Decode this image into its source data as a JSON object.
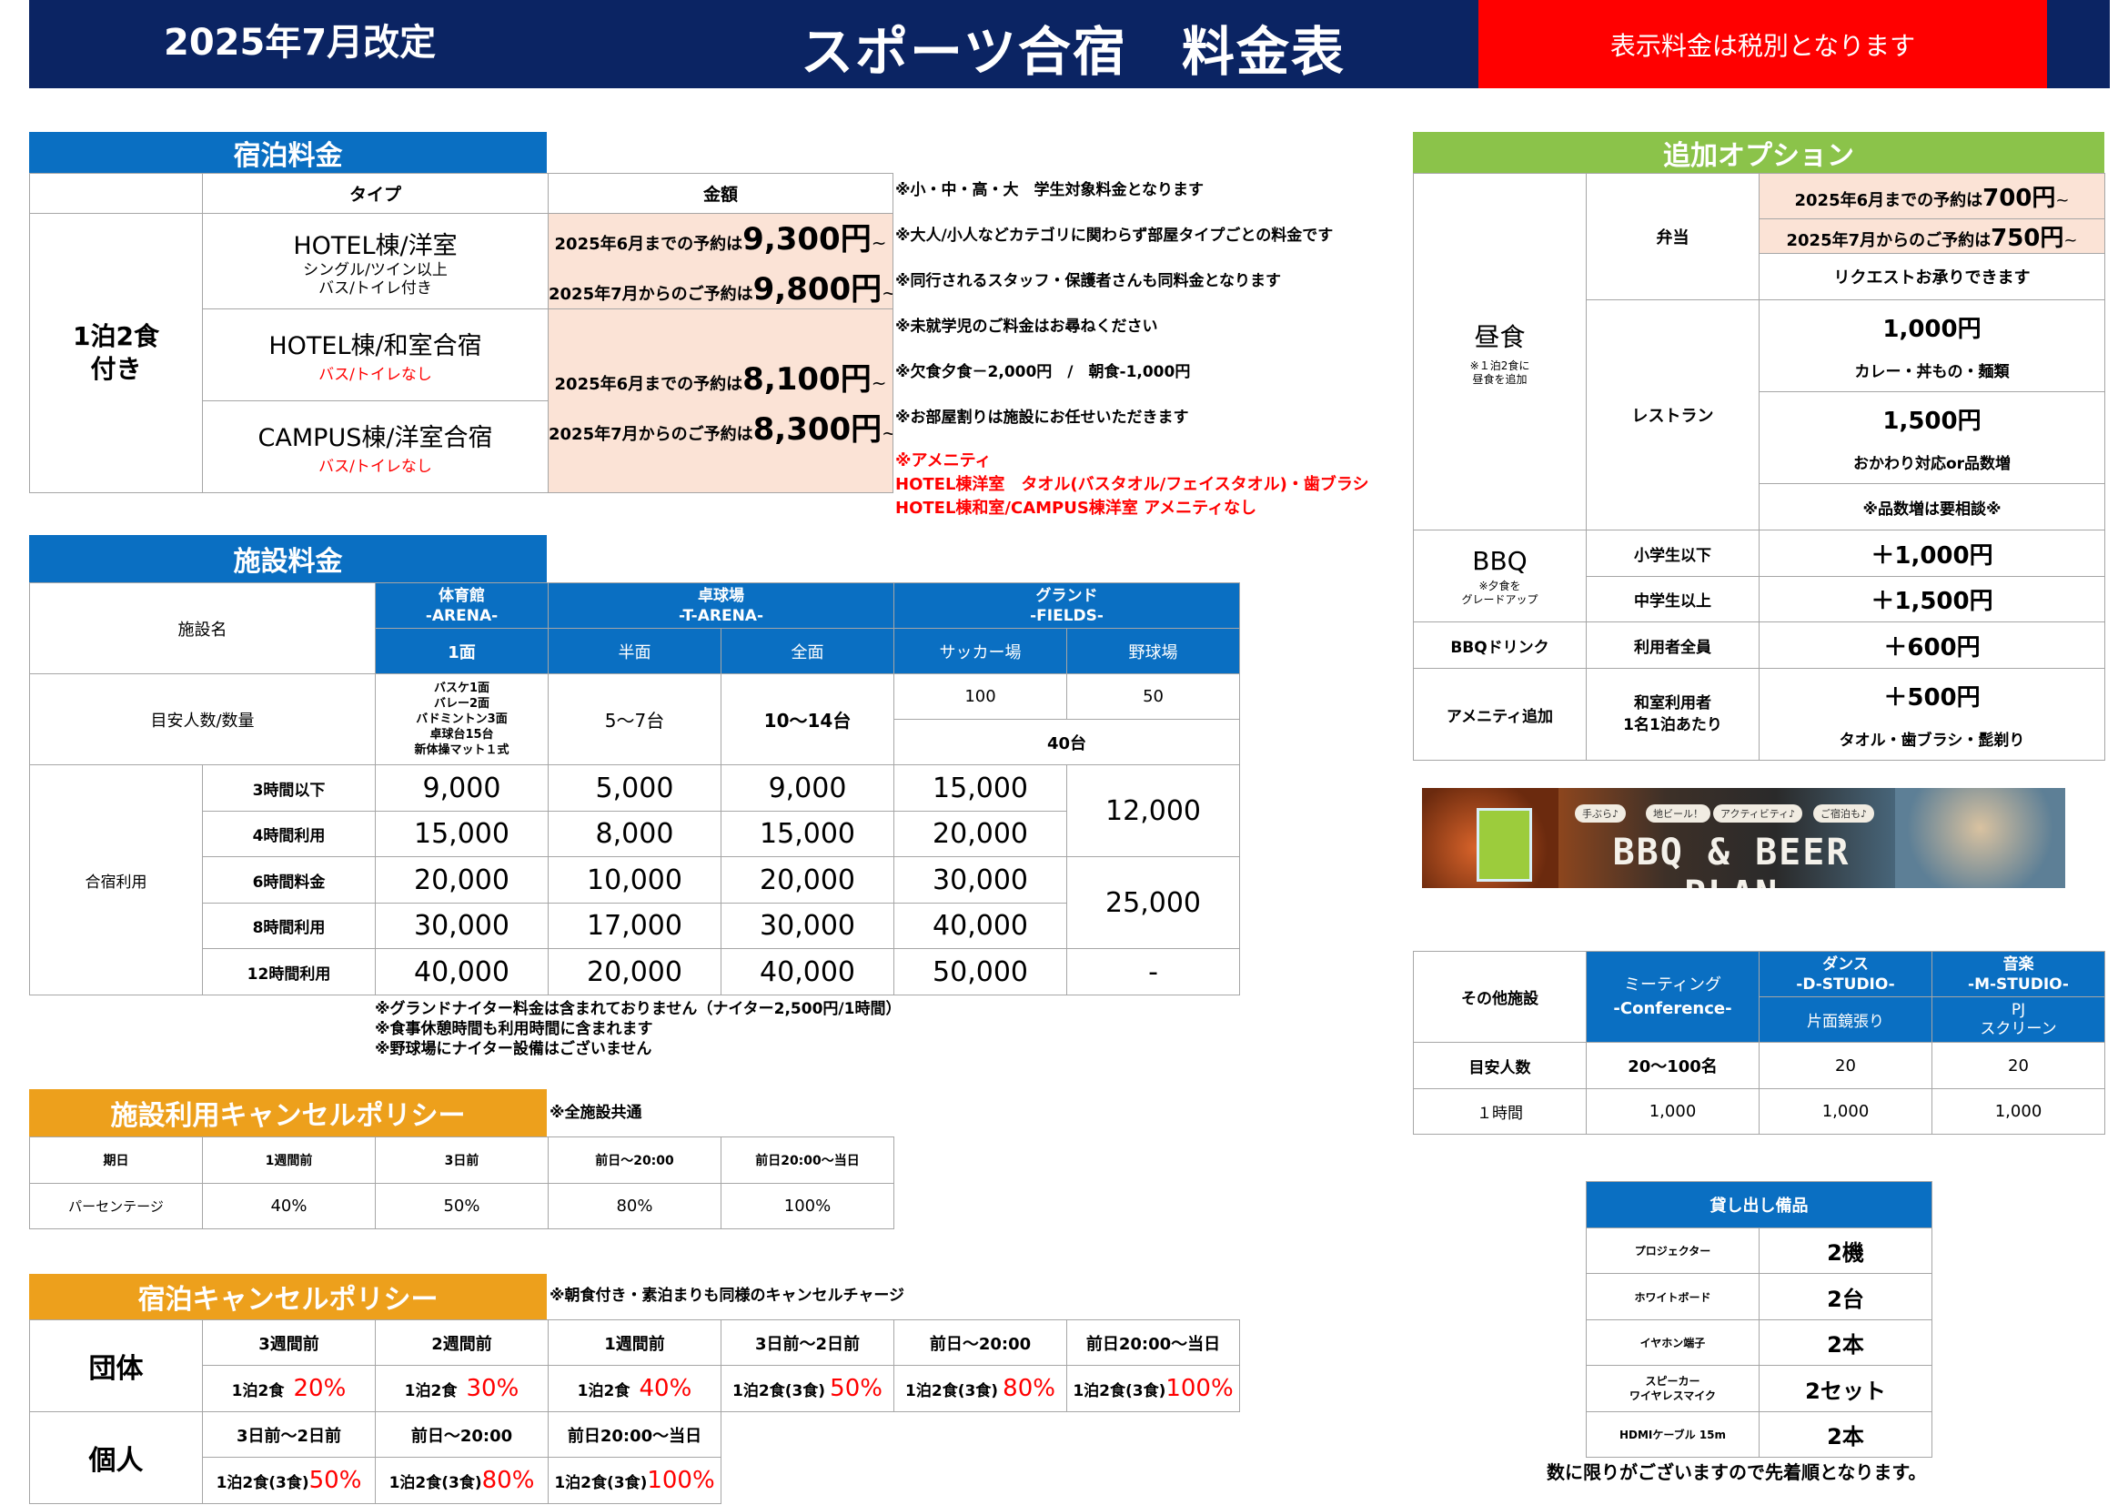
{
  "header": {
    "revision": "2025年7月改定",
    "title": "スポーツ合宿　料金表",
    "tax_note": "表示料金は税別となります"
  },
  "lodging": {
    "section_title": "宿泊料金",
    "col_type": "タイプ",
    "col_price": "金額",
    "plan": "1泊2食\n付き",
    "rooms": [
      {
        "name": "HOTEL棟/洋室",
        "sub1": "シングル/ツイン以上",
        "sub2": "バス/トイレ付き"
      },
      {
        "name": "HOTEL棟/和室合宿",
        "sub1": "バス/トイレなし"
      },
      {
        "name": "CAMPUS棟/洋室合宿",
        "sub1": "バス/トイレなし"
      }
    ],
    "price_a": {
      "line1_label": "2025年6月までの予約は",
      "line1_price": "9,300円",
      "line2_label": "2025年7月からのご予約は",
      "line2_price": "9,800円",
      "tilde": "~"
    },
    "price_b": {
      "line1_label": "2025年6月までの予約は",
      "line1_price": "8,100円",
      "line2_label": "2025年7月からのご予約は",
      "line2_price": "8,300円",
      "tilde": "~"
    },
    "notes": [
      "※小・中・高・大　学生対象料金となります",
      "※大人/小人などカテゴリに関わらず部屋タイプごとの料金です",
      "※同行されるスタッフ・保護者さんも同料金となります",
      "※未就学児のご料金はお尋ねください",
      "※欠食夕食－2,000円　/　朝食-1,000円",
      "※お部屋割りは施設にお任せいただきます"
    ],
    "amenity_notes": [
      "※アメニティ",
      "HOTEL棟洋室　タオル(バスタオル/フェイスタオル)・歯ブラシ",
      "HOTEL棟和室/CAMPUS棟洋室 アメニティなし"
    ]
  },
  "facility": {
    "section_title": "施設料金",
    "facility_name": "施設名",
    "arena": {
      "name": "体育館",
      "code": "-ARENA-",
      "sub": "1面"
    },
    "t_arena": {
      "name": "卓球場",
      "code": "-T-ARENA-",
      "half": "半面",
      "full": "全面"
    },
    "fields": {
      "name": "グランド",
      "code": "-FIELDS-",
      "soccer": "サッカー場",
      "baseball": "野球場"
    },
    "capacity_label": "目安人数/数量",
    "arena_capacity": [
      "バスケ1面",
      "バレー2面",
      "バドミントン3面",
      "卓球台15台",
      "新体操マット１式"
    ],
    "t_half_capacity": "5～7台",
    "t_full_capacity": "10～14台",
    "soccer_capacity": "100",
    "baseball_capacity": "50",
    "fields_count": "40台",
    "usage_label": "合宿利用",
    "rows": [
      {
        "label": "3時間以下",
        "values": [
          "9,000",
          "5,000",
          "9,000",
          "15,000"
        ]
      },
      {
        "label": "4時間利用",
        "values": [
          "15,000",
          "8,000",
          "15,000",
          "20,000"
        ]
      },
      {
        "label": "6時間料金",
        "values": [
          "20,000",
          "10,000",
          "20,000",
          "30,000"
        ]
      },
      {
        "label": "8時間利用",
        "values": [
          "30,000",
          "17,000",
          "30,000",
          "40,000"
        ]
      },
      {
        "label": "12時間利用",
        "values": [
          "40,000",
          "20,000",
          "40,000",
          "50,000"
        ]
      }
    ],
    "baseball_prices": [
      "12,000",
      "25,000",
      "-"
    ],
    "notes": [
      "※グランドナイター料金は含まれておりません（ナイター2,500円/1時間）",
      "※食事休憩時間も利用時間に含まれます",
      "※野球場にナイター設備はございません"
    ]
  },
  "facility_cancel": {
    "section_title": "施設利用キャンセルポリシー",
    "note": "※全施設共通",
    "header": [
      "期日",
      "1週間前",
      "3日前",
      "前日～20:00",
      "前日20:00～当日"
    ],
    "row": [
      "パーセンテージ",
      "40%",
      "50%",
      "80%",
      "100%"
    ]
  },
  "lodging_cancel": {
    "section_title": "宿泊キャンセルポリシー",
    "note": "※朝食付き・素泊まりも同様のキャンセルチャージ",
    "group_label": "団体",
    "group_headers": [
      "3週間前",
      "2週間前",
      "1週間前",
      "3日前～2日前",
      "前日～20:00",
      "前日20:00～当日"
    ],
    "group_meals": [
      "1泊2食",
      "1泊2食",
      "1泊2食",
      "1泊2食(3食)",
      "1泊2食(3食)",
      "1泊2食(3食)"
    ],
    "group_pcts": [
      "20%",
      "30%",
      "40%",
      "50%",
      "80%",
      "100%"
    ],
    "individual_label": "個人",
    "individual_headers": [
      "3日前～2日前",
      "前日～20:00",
      "前日20:00～当日"
    ],
    "individual_meals": [
      "1泊2食(3食)",
      "1泊2食(3食)",
      "1泊2食(3食)"
    ],
    "individual_pcts": [
      "50%",
      "80%",
      "100%"
    ]
  },
  "options": {
    "section_title": "追加オプション",
    "lunch_label": "昼食",
    "lunch_note": [
      "※１泊2食に",
      "昼食を追加"
    ],
    "bento_label": "弁当",
    "bento_price1_label": "2025年6月までの予約は",
    "bento_price1": "700円",
    "bento_price2_label": "2025年7月からのご予約は",
    "bento_price2": "750円",
    "tilde": "~",
    "bento_request": "リクエストお承りできます",
    "restaurant_label": "レストラン",
    "rest_price1": "1,000円",
    "rest_desc1": "カレー・丼もの・麺類",
    "rest_price2": "1,500円",
    "rest_desc2": "おかわり対応or品数増",
    "rest_note": "※品数増は要相談※",
    "bbq_label": "BBQ",
    "bbq_note": [
      "※夕食を",
      "グレードアップ"
    ],
    "bbq_elem_label": "小学生以下",
    "bbq_elem_price": "＋1,000円",
    "bbq_mid_label": "中学生以上",
    "bbq_mid_price": "＋1,500円",
    "drink_label": "BBQドリンク",
    "drink_who": "利用者全員",
    "drink_price": "＋600円",
    "amenity_label": "アメニティ追加",
    "amenity_who": "和室利用者\n1名1泊あたり",
    "amenity_price": "＋500円",
    "amenity_desc": "タオル・歯ブラシ・髭剃り"
  },
  "banner": {
    "text": "BBQ & BEER PLAN",
    "tags": [
      "手ぶら♪",
      "地ビール！",
      "アクティビティ♪",
      "ご宿泊も♪"
    ]
  },
  "other_facilities": {
    "label": "その他施設",
    "meeting": {
      "name": "ミーティング",
      "code": "-Conference-"
    },
    "dance": {
      "name": "ダンス",
      "code": "-D-STUDIO-",
      "sub": "片面鏡張り"
    },
    "music": {
      "name": "音楽",
      "code": "-M-STUDIO-",
      "sub": "PJ\nスクリーン"
    },
    "capacity_label": "目安人数",
    "capacity": [
      "20～100名",
      "20",
      "20"
    ],
    "hour_label": "１時間",
    "hour_prices": [
      "1,000",
      "1,000",
      "1,000"
    ]
  },
  "rental": {
    "title": "貸し出し備品",
    "items": [
      {
        "name": "プロジェクター",
        "qty": "2機"
      },
      {
        "name": "ホワイトボード",
        "qty": "2台"
      },
      {
        "name": "イヤホン端子",
        "qty": "2本"
      },
      {
        "name": "スピーカー\nワイヤレスマイク",
        "qty": "2セット"
      },
      {
        "name": "HDMIケーブル 15m",
        "qty": "2本"
      }
    ],
    "note": "数に限りがございますので先着順となります。"
  },
  "colors": {
    "navy": "#0b2463",
    "red": "#ff0000",
    "blue": "#0a6fc2",
    "green": "#8bc34a",
    "orange": "#eda01c",
    "peach": "#fbe3d6"
  }
}
